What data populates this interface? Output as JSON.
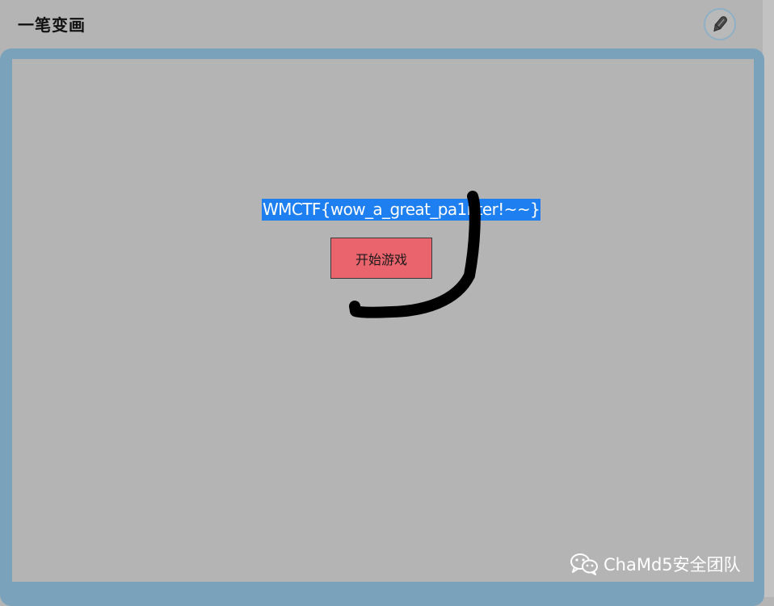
{
  "app": {
    "title": "一笔变画",
    "pen_icon": "pen-icon"
  },
  "game": {
    "flag_text": "WMCTF{wow_a_great_pa1nter!~~}",
    "start_label": "开始游戏",
    "stroke_color": "#000000"
  },
  "watermark": {
    "text": "ChaMd5安全团队",
    "icon": "wechat-icon"
  },
  "colors": {
    "canvas_bg": "#b4b4b4",
    "frame": "#7aa3bb",
    "flag_highlight": "#1e7ff0",
    "start_button": "#e9646c"
  }
}
